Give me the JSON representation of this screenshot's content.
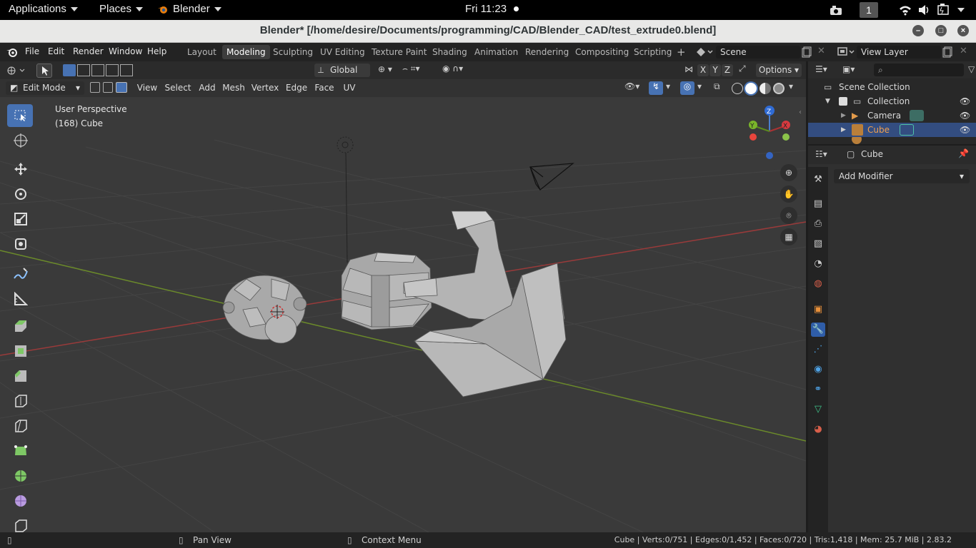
{
  "os": {
    "applications": "Applications",
    "places": "Places",
    "app_name": "Blender",
    "clock": "Fri 11:23",
    "workspace_number": "1"
  },
  "window": {
    "title": "Blender* [/home/desire/Documents/programming/CAD/Blender_CAD/test_extrude0.blend]"
  },
  "menu": {
    "file": "File",
    "edit": "Edit",
    "render": "Render",
    "window": "Window",
    "help": "Help"
  },
  "workspaces": [
    "Layout",
    "Modeling",
    "Sculpting",
    "UV Editing",
    "Texture Paint",
    "Shading",
    "Animation",
    "Rendering",
    "Compositing",
    "Scripting"
  ],
  "active_workspace": "Modeling",
  "scene": {
    "name": "Scene"
  },
  "view_layer": {
    "name": "View Layer"
  },
  "viewport_header": {
    "orientation": "Global",
    "options": "Options",
    "mode": "Edit Mode",
    "menus": [
      "View",
      "Select",
      "Add",
      "Mesh",
      "Vertex",
      "Edge",
      "Face",
      "UV"
    ],
    "axes": [
      "X",
      "Y",
      "Z"
    ]
  },
  "viewport": {
    "perspective": "User Perspective",
    "object_info": "(168) Cube",
    "gizmo": {
      "x": "X",
      "y": "Y",
      "z": "Z"
    },
    "colors": {
      "grid_x": "#9a3a3a",
      "grid_y": "#6b8a2a",
      "bg": "#3a3a3a"
    }
  },
  "outliner": {
    "root": "Scene Collection",
    "collection": "Collection",
    "items": [
      {
        "label": "Camera",
        "selected": false
      },
      {
        "label": "Cube",
        "selected": true
      }
    ]
  },
  "properties": {
    "object_name": "Cube",
    "add_modifier": "Add Modifier"
  },
  "status": {
    "pan": "Pan View",
    "context": "Context Menu",
    "stats": "Cube | Verts:0/751 | Edges:0/1,452 | Faces:0/720 | Tris:1,418 | Mem: 25.7 MiB | 2.83.2"
  }
}
